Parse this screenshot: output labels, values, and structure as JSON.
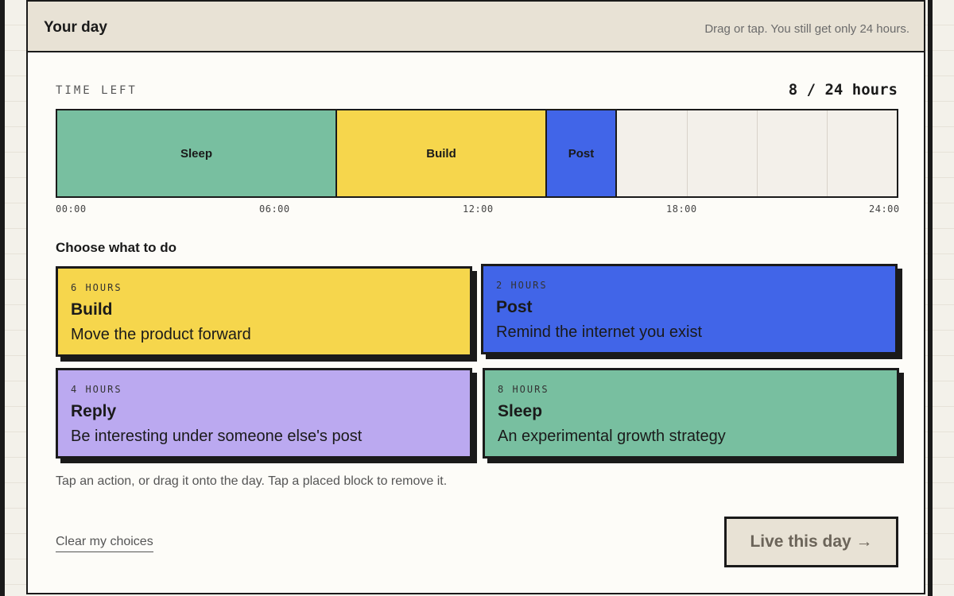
{
  "header": {
    "title": "Your day",
    "hint": "Drag or tap. You still get only 24 hours."
  },
  "timeline": {
    "label": "TIME LEFT",
    "readout": "8 / 24 hours",
    "hours_used": 16,
    "hours_total": 24,
    "ticks": [
      "00:00",
      "06:00",
      "12:00",
      "18:00",
      "24:00"
    ],
    "placed_blocks": [
      {
        "label": "Sleep",
        "hours": 8,
        "color": "#78bfa0"
      },
      {
        "label": "Build",
        "hours": 6,
        "color": "#f6d64c"
      },
      {
        "label": "Post",
        "hours": 2,
        "color": "#4165e8"
      }
    ]
  },
  "choose": {
    "heading": "Choose what to do",
    "cards": [
      {
        "hours": "6 HOURS",
        "title": "Build",
        "desc": "Move the product forward",
        "color": "#f6d64c"
      },
      {
        "hours": "2 HOURS",
        "title": "Post",
        "desc": "Remind the internet you exist",
        "color": "#4165e8"
      },
      {
        "hours": "4 HOURS",
        "title": "Reply",
        "desc": "Be interesting under someone else's post",
        "color": "#bba9f0"
      },
      {
        "hours": "8 HOURS",
        "title": "Sleep",
        "desc": "An experimental growth strategy",
        "color": "#78bfa0"
      }
    ]
  },
  "help_text": "Tap an action, or drag it onto the day. Tap a placed block to remove it.",
  "clear_label": "Clear my choices",
  "live_label": "Live this day →"
}
